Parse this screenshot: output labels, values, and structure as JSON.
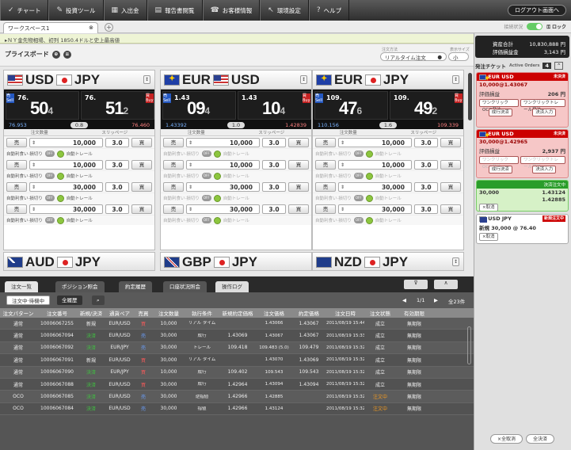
{
  "nav": {
    "items": [
      {
        "icon": "✓",
        "label": "チャート",
        "icon_name": "chart-icon"
      },
      {
        "icon": "✎",
        "label": "投資ツール",
        "icon_name": "tools-icon"
      },
      {
        "icon": "▦",
        "label": "入出金",
        "icon_name": "deposit-icon"
      },
      {
        "icon": "▤",
        "label": "報告書閲覧",
        "icon_name": "report-icon"
      },
      {
        "icon": "☎",
        "label": "お客様情報",
        "icon_name": "customer-icon"
      },
      {
        "icon": "↖",
        "label": "環境設定",
        "icon_name": "settings-icon"
      },
      {
        "icon": "?",
        "label": "ヘルプ",
        "icon_name": "help-icon"
      }
    ],
    "logout": "ログアウト画面へ"
  },
  "workspace": {
    "tab": "ワークスペース1",
    "add": "+"
  },
  "status": {
    "label": "接続状況",
    "lock": "ロック"
  },
  "news": "▸ＮＹ金先物相場、初列 1850.4ドルと史上最高値",
  "priceboard": {
    "title": "プライスボード",
    "order_type_label": "注文方法",
    "order_type": "リアルタイム注文",
    "size_label": "表示サイズ",
    "size": "小"
  },
  "labels": {
    "qty": "注文数量",
    "slip": "スリッページ",
    "sell": "売",
    "buy": "買",
    "auto_limit": "自動利食い·損切り",
    "auto_trail": "自動トレール",
    "off": "OFF",
    "sell_side": "売 Sell",
    "buy_side": "買 Buy"
  },
  "panels": [
    {
      "name": "USD/JPY",
      "base": "USD",
      "quote": "JPY",
      "bid_pre": "76.",
      "bid_big": "50",
      "bid_frac": "4",
      "ask_pre": "76.",
      "ask_big": "51",
      "ask_frac": "2",
      "low": "76.953",
      "spread": "0.8",
      "high": "76.460",
      "qty": [
        "10,000",
        "10,000",
        "30,000",
        "30,000"
      ],
      "slip": "3.0"
    },
    {
      "name": "EUR/USD",
      "base": "EUR",
      "quote": "USD",
      "bid_pre": "1.43",
      "bid_big": "09",
      "bid_frac": "4",
      "ask_pre": "1.43",
      "ask_big": "10",
      "ask_frac": "4",
      "low": "1.43392",
      "spread": "1.0",
      "high": "1.42839",
      "qty": [
        "10,000",
        "10,000",
        "30,000",
        "30,000"
      ],
      "slip": "3.0"
    },
    {
      "name": "EUR/JPY",
      "base": "EUR",
      "quote": "JPY",
      "bid_pre": "109.",
      "bid_big": "47",
      "bid_frac": "6",
      "ask_pre": "109.",
      "ask_big": "49",
      "ask_frac": "2",
      "low": "110.156",
      "spread": "1.6",
      "high": "109.339",
      "qty": [
        "10,000",
        "10,000",
        "30,000",
        "30,000"
      ],
      "slip": "3.0"
    }
  ],
  "panels_row2": [
    {
      "base": "AUD",
      "quote": "JPY"
    },
    {
      "base": "GBP",
      "quote": "JPY"
    },
    {
      "base": "NZD",
      "quote": "JPY"
    }
  ],
  "bottom_tabs": [
    "注文一覧",
    "ポジション照会",
    "約定履歴",
    "口座状況照会",
    "操作ログ"
  ],
  "filters": {
    "pending": "注文中·待機中",
    "all": "全履歴",
    "page": "1/1",
    "count": "全23件"
  },
  "table": {
    "headers": [
      "注文パターン",
      "注文番号",
      "新規/決済",
      "通貨ペア",
      "売買",
      "注文数量",
      "執行条件",
      "新規約定価格",
      "注文価格",
      "約定価格",
      "注文日時",
      "注文状態",
      "有効期限"
    ],
    "rows": [
      {
        "pattern": "通常",
        "no": "10006067255",
        "type": "新規",
        "pair": "EUR/USD",
        "side": "買",
        "qty": "10,000",
        "cond": "リアル タイム",
        "newprice": "",
        "price": "1.43066",
        "exec": "1.43067",
        "date": "2011/08/19 15:44:33",
        "status": "成立",
        "expiry": "無期限"
      },
      {
        "pattern": "通常",
        "no": "10006067094",
        "type": "決済",
        "pair": "EUR/USD",
        "side": "売",
        "qty": "30,000",
        "cond": "成行",
        "newprice": "1.43069",
        "price": "1.43067",
        "exec": "1.43067",
        "date": "2011/08/19 15:33:16",
        "status": "成立",
        "expiry": "無期限"
      },
      {
        "pattern": "通常",
        "no": "10006067092",
        "type": "決済",
        "pair": "EUR/JPY",
        "side": "売",
        "qty": "30,000",
        "cond": "トレール",
        "newprice": "109.418",
        "price": "109.483 (5.0)",
        "exec": "109.479",
        "date": "2011/08/19 15:32:48",
        "status": "成立",
        "expiry": "無期限"
      },
      {
        "pattern": "通常",
        "no": "10006067091",
        "type": "新規",
        "pair": "EUR/USD",
        "side": "買",
        "qty": "30,000",
        "cond": "リアル タイム",
        "newprice": "",
        "price": "1.43070",
        "exec": "1.43069",
        "date": "2011/08/19 15:32:40",
        "status": "成立",
        "expiry": "無期限"
      },
      {
        "pattern": "通常",
        "no": "10006067090",
        "type": "決済",
        "pair": "EUR/JPY",
        "side": "買",
        "qty": "10,000",
        "cond": "成行",
        "newprice": "109.402",
        "price": "109.543",
        "exec": "109.543",
        "date": "2011/08/19 15:32:22",
        "status": "成立",
        "expiry": "無期限"
      },
      {
        "pattern": "通常",
        "no": "10006067088",
        "type": "決済",
        "pair": "EUR/USD",
        "side": "買",
        "qty": "30,000",
        "cond": "成行",
        "newprice": "1.42964",
        "price": "1.43094",
        "exec": "1.43094",
        "date": "2011/08/19 15:32:16",
        "status": "成立",
        "expiry": "無期限"
      },
      {
        "pattern": "OCO",
        "no": "10006067085",
        "type": "決済",
        "pair": "EUR/USD",
        "side": "売",
        "qty": "30,000",
        "cond": "逆指値",
        "newprice": "1.42966",
        "price": "1.42885",
        "exec": "",
        "date": "2011/08/19 15:32:09",
        "status": "注文中",
        "expiry": "無期限"
      },
      {
        "pattern": "OCO",
        "no": "10006067084",
        "type": "決済",
        "pair": "EUR/USD",
        "side": "売",
        "qty": "30,000",
        "cond": "指値",
        "newprice": "1.42966",
        "price": "1.43124",
        "exec": "",
        "date": "2011/08/19 15:32:09",
        "status": "注文中",
        "expiry": "無期限"
      }
    ]
  },
  "account": {
    "asset_label": "資産合計",
    "asset": "10,830,888 円",
    "margin_label": "評価損益金",
    "margin": "3,143 円"
  },
  "ticket": {
    "title": "発注チケット",
    "active": "Active Orders",
    "count": "4"
  },
  "cards": [
    {
      "pair": "EUR USD",
      "badge": "未決済",
      "line": "10,000@1.43067",
      "pnl_label": "評価損益",
      "pnl": "206 円",
      "b1": "ワンクリックOCO発注",
      "b2": "ワンクリックトレール発注",
      "b3": "成行決済",
      "b4": "決済入力"
    },
    {
      "pair": "EUR USD",
      "badge": "未決済",
      "line": "30,000@1.42965",
      "pnl_label": "評価損益",
      "pnl": "2,937 円",
      "b1": "ワンクリックOCO発注",
      "b2": "ワンクリックトレール発注",
      "b3": "成行決済",
      "b4": "決済入力"
    },
    {
      "badge": "決済注文中",
      "qty": "30,000",
      "l1": "1.43124",
      "l2": "1.42885",
      "cancel": "×取消"
    },
    {
      "pair": "USD JPY",
      "badge": "新規注文中",
      "line": "新規 30,000 @ 76.40",
      "cancel": "×取消"
    }
  ],
  "right_bottom": {
    "cancel_all": "×全取消",
    "settle_all": "全決済"
  }
}
